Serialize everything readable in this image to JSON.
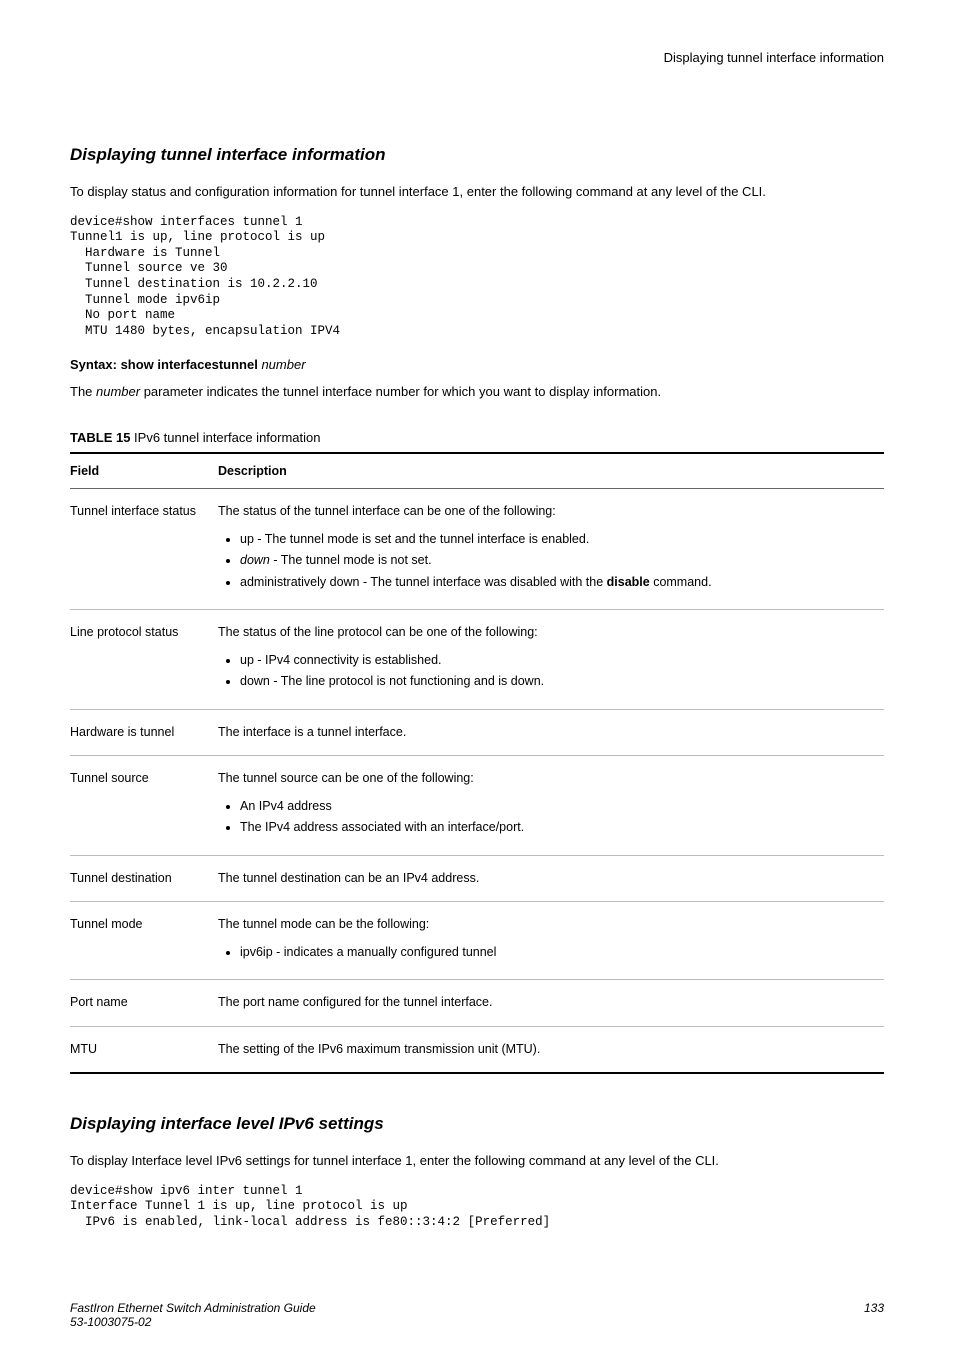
{
  "header": {
    "right": "Displaying tunnel interface information"
  },
  "s1": {
    "title": "Displaying tunnel interface information",
    "intro": "To display status and configuration information for tunnel interface 1, enter the following command at any level of the CLI.",
    "code": "device#show interfaces tunnel 1\nTunnel1 is up, line protocol is up\n  Hardware is Tunnel\n  Tunnel source ve 30\n  Tunnel destination is 10.2.2.10\n  Tunnel mode ipv6ip\n  No port name\n  MTU 1480 bytes, encapsulation IPV4",
    "syntax": {
      "lead": "Syntax: show interfacestunnel",
      "param": "number"
    },
    "param_desc": {
      "pre": "The ",
      "word": "number",
      "post": " parameter indicates the tunnel interface number for which you want to display information."
    },
    "table_title": {
      "lead": "TABLE 15",
      "rest": "   IPv6 tunnel interface information"
    },
    "th": {
      "field": "Field",
      "desc": "Description"
    },
    "rows": {
      "r0": {
        "field": "Tunnel interface status",
        "desc": "The status of the tunnel interface can be one of the following:",
        "b0": "up - The tunnel mode is set and the tunnel interface is enabled.",
        "b1_pre": "down",
        "b1_post": " - The tunnel mode is not set.",
        "b2_pre": "administratively down - The tunnel interface was disabled with the ",
        "b2_word": "disable",
        "b2_post": " command."
      },
      "r1": {
        "field": "Line protocol status",
        "desc": "The status of the line protocol can be one of the following:",
        "b0": "up - IPv4 connectivity is established.",
        "b1": "down - The line protocol is not functioning and is down."
      },
      "r2": {
        "field": "Hardware is tunnel",
        "desc": "The interface is a tunnel interface."
      },
      "r3": {
        "field": "Tunnel source",
        "desc": "The tunnel source can be one of the following:",
        "b0": "An IPv4 address",
        "b1": "The IPv4 address associated with an interface/port."
      },
      "r4": {
        "field": "Tunnel destination",
        "desc": "The tunnel destination can be an IPv4 address."
      },
      "r5": {
        "field": "Tunnel mode",
        "desc": "The tunnel mode can be the following:",
        "b0": "ipv6ip - indicates a manually configured tunnel"
      },
      "r6": {
        "field": "Port name",
        "desc": "The port name configured for the tunnel interface."
      },
      "r7": {
        "field": "MTU",
        "desc": "The setting of the IPv6 maximum transmission unit (MTU)."
      }
    }
  },
  "s2": {
    "title": "Displaying interface level IPv6 settings",
    "intro": "To display Interface level IPv6 settings for tunnel interface 1, enter the following command at any level of the CLI.",
    "code": "device#show ipv6 inter tunnel 1\nInterface Tunnel 1 is up, line protocol is up\n  IPv6 is enabled, link-local address is fe80::3:4:2 [Preferred]"
  },
  "footer": {
    "left1": "FastIron Ethernet Switch Administration Guide",
    "left2": "53-1003075-02",
    "page": "133"
  }
}
